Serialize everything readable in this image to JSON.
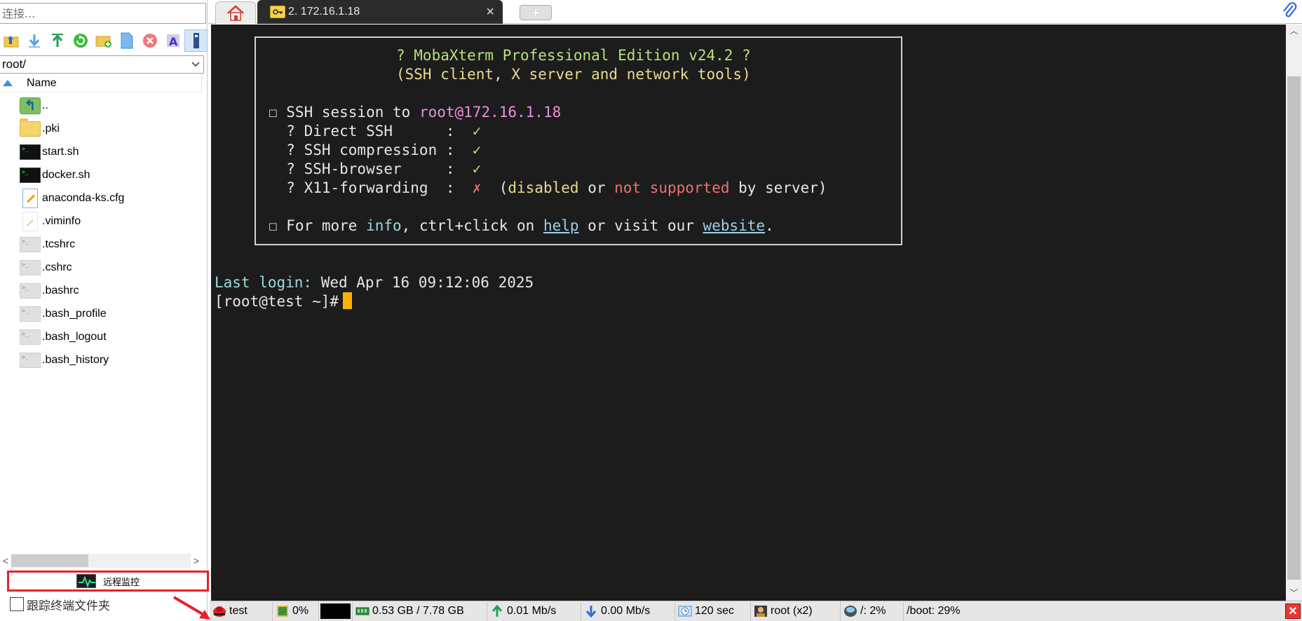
{
  "sidebar": {
    "connect_placeholder": "连接...",
    "path": "root/",
    "name_header": "Name",
    "files": [
      {
        "name": "..",
        "icon": "parent-folder-icon"
      },
      {
        "name": ".pki",
        "icon": "folder-icon"
      },
      {
        "name": "start.sh",
        "icon": "shell-script-icon"
      },
      {
        "name": "docker.sh",
        "icon": "shell-script-icon"
      },
      {
        "name": "anaconda-ks.cfg",
        "icon": "config-file-icon"
      },
      {
        "name": ".viminfo",
        "icon": "text-file-icon"
      },
      {
        "name": ".tcshrc",
        "icon": "hidden-script-icon"
      },
      {
        "name": ".cshrc",
        "icon": "hidden-script-icon"
      },
      {
        "name": ".bashrc",
        "icon": "hidden-script-icon"
      },
      {
        "name": ".bash_profile",
        "icon": "hidden-script-icon"
      },
      {
        "name": ".bash_logout",
        "icon": "hidden-script-icon"
      },
      {
        "name": ".bash_history",
        "icon": "hidden-script-icon"
      }
    ],
    "monitor_label": "远程监控",
    "follow_label": "跟踪终端文件夹"
  },
  "tabs": {
    "session_label": "2. 172.16.1.18",
    "close_glyph": "×",
    "new_glyph": "+"
  },
  "terminal": {
    "title_line": "? MobaXterm Professional Edition v24.2 ?",
    "subtitle_line": "(SSH client, X server and network tools)",
    "session_prefix": "☐ SSH session to ",
    "session_host": "root@172.16.1.18",
    "direct_ssh": "  ? Direct SSH      :  ",
    "compression": "  ? SSH compression :  ",
    "browser": "  ? SSH-browser     :  ",
    "x11": "  ? X11-forwarding  :  ",
    "check": "✓",
    "cross": "✗",
    "x11_paren_open": "  (",
    "x11_disabled": "disabled",
    "x11_or": " or ",
    "x11_not_supported": "not supported",
    "x11_by_server": " by server)",
    "more_prefix": "☐ For more ",
    "more_info": "info",
    "more_ctrl": ", ctrl+click on ",
    "more_help": "help",
    "more_visit": " or visit our ",
    "more_website": "website",
    "more_dot": ".",
    "last_login_label": "Last login:",
    "last_login_value": " Wed Apr 16 09:12:06 2025",
    "prompt": "[root@test ~]#"
  },
  "statusbar": {
    "host": "test",
    "cpu": "0%",
    "memory": "0.53 GB / 7.78 GB",
    "upload": "0.01 Mb/s",
    "download": "0.00 Mb/s",
    "uptime": "120 sec",
    "users": "root  (x2)",
    "disk_root": "/: 2%",
    "disk_boot": "/boot: 29%"
  },
  "colors": {
    "terminal_bg": "#1c1c1c",
    "accent_red": "#e8202a",
    "cursor": "#ffb000"
  }
}
